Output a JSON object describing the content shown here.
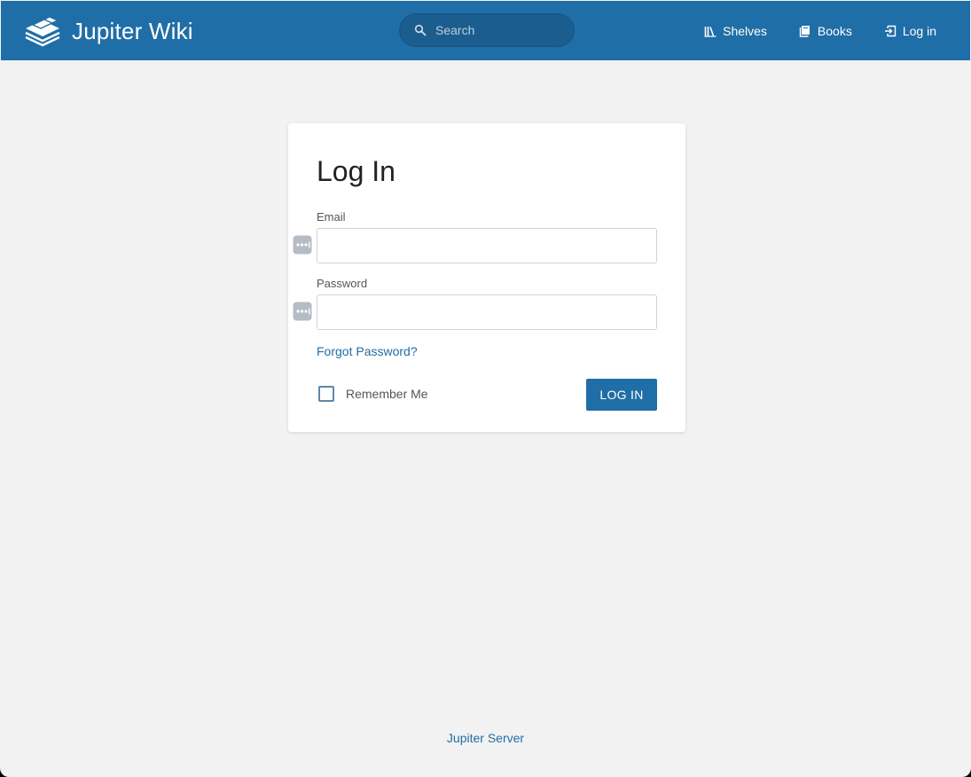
{
  "header": {
    "logo_text": "Jupiter Wiki",
    "search": {
      "placeholder": "Search",
      "value": ""
    },
    "nav": [
      {
        "label": "Shelves",
        "icon": "shelves-icon"
      },
      {
        "label": "Books",
        "icon": "books-icon"
      },
      {
        "label": "Log in",
        "icon": "login-icon"
      }
    ]
  },
  "login": {
    "title": "Log In",
    "email_label": "Email",
    "email_value": "",
    "password_label": "Password",
    "password_value": "",
    "forgot_label": "Forgot Password?",
    "remember_label": "Remember Me",
    "remember_checked": false,
    "submit_label": "LOG IN"
  },
  "footer": {
    "link_label": "Jupiter Server"
  },
  "colors": {
    "primary": "#206ea7",
    "page_background": "#f2f2f2",
    "card_background": "#ffffff",
    "password_manager_icon": "#b6bcc6"
  }
}
